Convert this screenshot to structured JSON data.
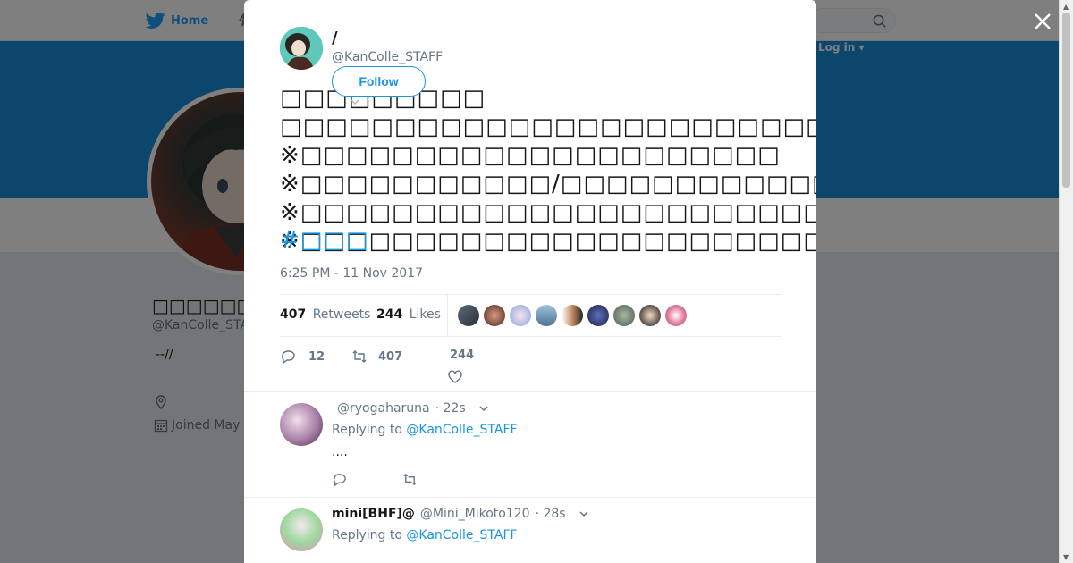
{
  "nav": {
    "home_label": "Home",
    "login_label": "Log in ▾"
  },
  "profile": {
    "name": "□□□□□□□□□/□",
    "handle": "@KanColle_STAFF",
    "bio": "--//",
    "joined": "Joined May"
  },
  "tweet": {
    "author_name": "/",
    "author_handle": "@KanColle_STAFF",
    "follow_label": "Follow",
    "text": "□□□□□□□□□ □□□□□□□□□□□□□□□□□□□□□□□□□□□□□□□□□□□□□□□□□□□□□□\n※□□□□□□□□□□□□□□□□□□□□□\n※□□□□□□□□□□□/□□□□□□□□□□□□□□□□□\n※□□□□□□□□□□□□□□□□□□□□□□□□□□□□□\n※□□□□□□□□□□□□□□□□□□□□□□□□□□□□□□□□□□□□□□□□□□□",
    "hashtag": "#□□□",
    "timestamp": "6:25 PM - 11 Nov 2017",
    "retweets_count": "407",
    "retweets_label": "Retweets",
    "likes_count": "244",
    "likes_label": "Likes",
    "reply_count": "12",
    "retweet_action_count": "407",
    "like_action_count": "244"
  },
  "colors": {
    "accent": "#1b95e0",
    "banner": "#1a8cd8"
  },
  "replies": [
    {
      "name": "",
      "handle": "@ryogaharuna",
      "time": "· 22s",
      "replying_prefix": "Replying to",
      "replying_to": "@KanColle_STAFF",
      "text": "...."
    },
    {
      "name": "mini[BHF]@",
      "handle": "@Mini_Mikoto120",
      "time": "· 28s",
      "replying_prefix": "Replying to",
      "replying_to": "@KanColle_STAFF",
      "text": ""
    }
  ]
}
